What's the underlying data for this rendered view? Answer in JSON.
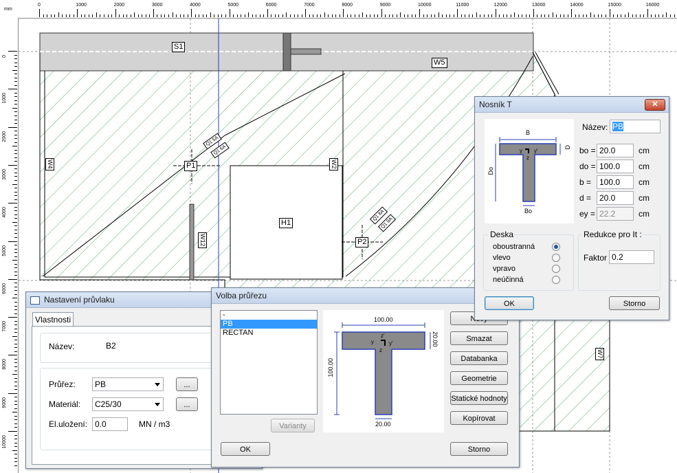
{
  "ruler": {
    "unit": "mm",
    "top_ticks": [
      "0",
      "1000",
      "2000",
      "3000",
      "4000",
      "5000",
      "6000",
      "7000",
      "8000",
      "9000",
      "10000",
      "11000",
      "12000",
      "13000",
      "14000",
      "15000",
      "16000"
    ],
    "left_ticks": [
      "0",
      "1000",
      "2000",
      "3000",
      "4000",
      "5000",
      "6000",
      "7000",
      "8000",
      "9000",
      "10000"
    ]
  },
  "plan": {
    "labels": {
      "s1": "S1",
      "w5": "W5",
      "p1": "P1",
      "p2": "P2",
      "h1": "H1",
      "w4": "W4",
      "w2": "W2",
      "w12": "W12",
      "w7": "W7",
      "q1": "Q1 5A",
      "q2": "Q1 6A",
      "q3": "Q1 8A",
      "q4": "Q1 9A"
    }
  },
  "nastaveni": {
    "title": "Nastavení průvlaku",
    "tab": "Vlastnosti",
    "nazev_label": "Název:",
    "nazev_value": "B2",
    "prurez_label": "Průřez:",
    "prurez_value": "PB",
    "material_label": "Materiál:",
    "material_value": "C25/30",
    "eluloz_label": "El.uložení:",
    "eluloz_value": "0.0",
    "eluloz_unit": "MN / m3",
    "dots": "..."
  },
  "volba": {
    "title": "Volba průřezu",
    "list": [
      "-",
      "PB",
      "RECTAN"
    ],
    "selected_index": 1,
    "varianty": "Varianty",
    "ok": "OK",
    "storno": "Storno",
    "buttons": [
      "Nový",
      "Smazat",
      "Databanka",
      "Geometrie",
      "Statické hodnoty",
      "Kopírovat"
    ],
    "preview": {
      "top_width": "100.00",
      "height": "100.00",
      "flange": "20.00",
      "web": "20.00",
      "y": "y",
      "z": "z",
      "y2": "y'",
      "z2": "z'"
    }
  },
  "nosnik": {
    "title": "Nosník T",
    "nazev_label": "Název:",
    "nazev_value": "PB",
    "fields": [
      {
        "label": "bo =",
        "value": "20.0",
        "unit": "cm",
        "disabled": false
      },
      {
        "label": "do =",
        "value": "100.0",
        "unit": "cm",
        "disabled": false
      },
      {
        "label": "b =",
        "value": "100.0",
        "unit": "cm",
        "disabled": false
      },
      {
        "label": "d =",
        "value": "20.0",
        "unit": "cm",
        "disabled": false
      },
      {
        "label": "ey =",
        "value": "22.2",
        "unit": "cm",
        "disabled": true
      }
    ],
    "diagram": {
      "b": "B",
      "d": "D",
      "do": "Do",
      "bo": "Bo",
      "y": "y",
      "z": "z",
      "y2": "y'"
    },
    "deska_title": "Deska",
    "deska_options": [
      "oboustranná",
      "vlevo",
      "vpravo",
      "neúčinná"
    ],
    "deska_selected": 0,
    "redukce_title": "Redukce pro It :",
    "faktor_label": "Faktor",
    "faktor_value": "0.2",
    "ok": "OK",
    "storno": "Storno"
  }
}
